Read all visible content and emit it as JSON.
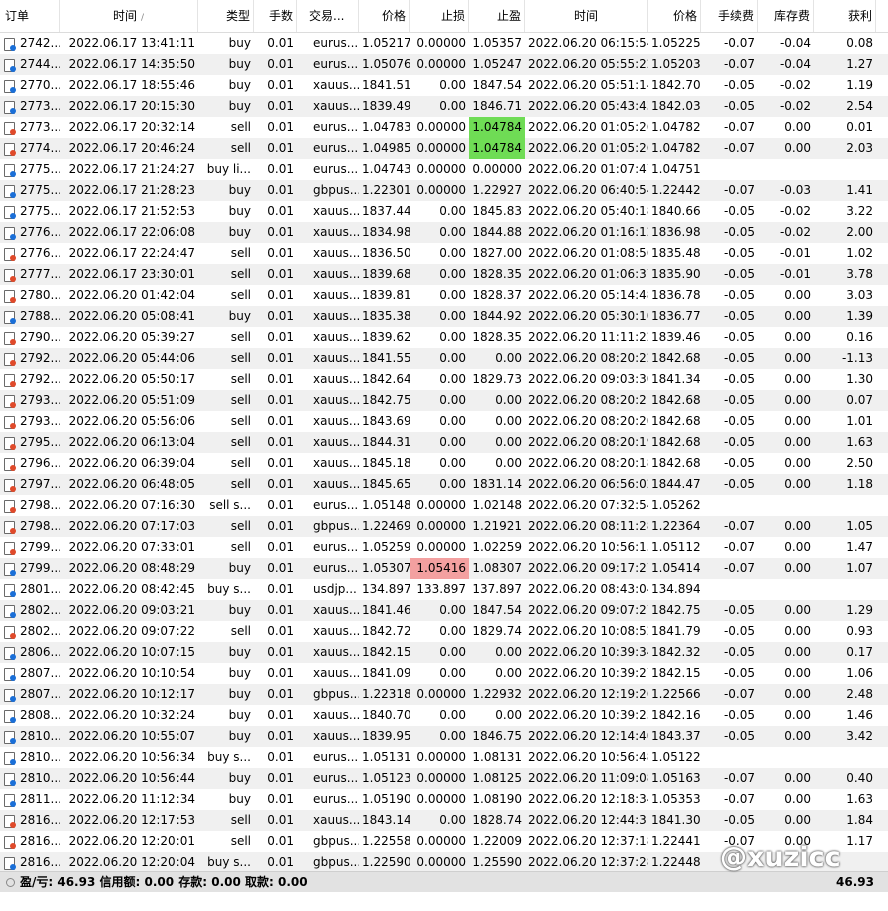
{
  "headers": [
    "订单",
    "时间",
    "类型",
    "手数",
    "交易...",
    "价格",
    "止损",
    "止盈",
    "时间",
    "价格",
    "手续费",
    "库存费",
    "获利"
  ],
  "sort_indicator": "/",
  "rows": [
    {
      "side": "buy",
      "c": [
        "2742...",
        "2022.06.17 13:41:11",
        "buy",
        "0.01",
        "eurus...",
        "1.05217",
        "0.00000",
        "1.05357",
        "2022.06.20 06:15:54",
        "1.05225",
        "-0.07",
        "-0.04",
        "0.08"
      ]
    },
    {
      "side": "buy",
      "c": [
        "2744...",
        "2022.06.17 14:35:50",
        "buy",
        "0.01",
        "eurus...",
        "1.05076",
        "0.00000",
        "1.05247",
        "2022.06.20 05:55:22",
        "1.05203",
        "-0.07",
        "-0.04",
        "1.27"
      ]
    },
    {
      "side": "buy",
      "c": [
        "2770...",
        "2022.06.17 18:55:46",
        "buy",
        "0.01",
        "xauus...",
        "1841.51",
        "0.00",
        "1847.54",
        "2022.06.20 05:51:14",
        "1842.70",
        "-0.05",
        "-0.02",
        "1.19"
      ]
    },
    {
      "side": "buy",
      "c": [
        "2773...",
        "2022.06.17 20:15:30",
        "buy",
        "0.01",
        "xauus...",
        "1839.49",
        "0.00",
        "1846.71",
        "2022.06.20 05:43:43",
        "1842.03",
        "-0.05",
        "-0.02",
        "2.54"
      ]
    },
    {
      "side": "sell",
      "c": [
        "2773...",
        "2022.06.17 20:32:14",
        "sell",
        "0.01",
        "eurus...",
        "1.04783",
        "0.00000",
        "1.04784",
        "2022.06.20 01:05:26",
        "1.04782",
        "-0.07",
        "0.00",
        "0.01"
      ],
      "hl": {
        "7": "g"
      }
    },
    {
      "side": "sell",
      "c": [
        "2774...",
        "2022.06.17 20:46:24",
        "sell",
        "0.01",
        "eurus...",
        "1.04985",
        "0.00000",
        "1.04784",
        "2022.06.20 01:05:26",
        "1.04782",
        "-0.07",
        "0.00",
        "2.03"
      ],
      "hl": {
        "7": "g"
      }
    },
    {
      "side": "buy",
      "c": [
        "2775...",
        "2022.06.17 21:24:27",
        "buy li...",
        "0.01",
        "eurus...",
        "1.04743",
        "0.00000",
        "0.00000",
        "2022.06.20 01:07:47",
        "1.04751",
        "",
        "",
        ""
      ]
    },
    {
      "side": "buy",
      "c": [
        "2775...",
        "2022.06.17 21:28:23",
        "buy",
        "0.01",
        "gbpus...",
        "1.22301",
        "0.00000",
        "1.22927",
        "2022.06.20 06:40:54",
        "1.22442",
        "-0.07",
        "-0.03",
        "1.41"
      ]
    },
    {
      "side": "buy",
      "c": [
        "2775...",
        "2022.06.17 21:52:53",
        "buy",
        "0.01",
        "xauus...",
        "1837.44",
        "0.00",
        "1845.83",
        "2022.06.20 05:40:18",
        "1840.66",
        "-0.05",
        "-0.02",
        "3.22"
      ]
    },
    {
      "side": "buy",
      "c": [
        "2776...",
        "2022.06.17 22:06:08",
        "buy",
        "0.01",
        "xauus...",
        "1834.98",
        "0.00",
        "1844.88",
        "2022.06.20 01:16:12",
        "1836.98",
        "-0.05",
        "-0.02",
        "2.00"
      ]
    },
    {
      "side": "sell",
      "c": [
        "2776...",
        "2022.06.17 22:24:47",
        "sell",
        "0.01",
        "xauus...",
        "1836.50",
        "0.00",
        "1827.00",
        "2022.06.20 01:08:56",
        "1835.48",
        "-0.05",
        "-0.01",
        "1.02"
      ]
    },
    {
      "side": "sell",
      "c": [
        "2777...",
        "2022.06.17 23:30:01",
        "sell",
        "0.01",
        "xauus...",
        "1839.68",
        "0.00",
        "1828.35",
        "2022.06.20 01:06:37",
        "1835.90",
        "-0.05",
        "-0.01",
        "3.78"
      ]
    },
    {
      "side": "sell",
      "c": [
        "2780...",
        "2022.06.20 01:42:04",
        "sell",
        "0.01",
        "xauus...",
        "1839.81",
        "0.00",
        "1828.37",
        "2022.06.20 05:14:48",
        "1836.78",
        "-0.05",
        "0.00",
        "3.03"
      ]
    },
    {
      "side": "buy",
      "c": [
        "2788...",
        "2022.06.20 05:08:41",
        "buy",
        "0.01",
        "xauus...",
        "1835.38",
        "0.00",
        "1844.92",
        "2022.06.20 05:30:10",
        "1836.77",
        "-0.05",
        "0.00",
        "1.39"
      ]
    },
    {
      "side": "sell",
      "c": [
        "2790...",
        "2022.06.20 05:39:27",
        "sell",
        "0.01",
        "xauus...",
        "1839.62",
        "0.00",
        "1828.35",
        "2022.06.20 11:11:22",
        "1839.46",
        "-0.05",
        "0.00",
        "0.16"
      ]
    },
    {
      "side": "sell",
      "c": [
        "2792...",
        "2022.06.20 05:44:06",
        "sell",
        "0.01",
        "xauus...",
        "1841.55",
        "0.00",
        "0.00",
        "2022.06.20 08:20:22",
        "1842.68",
        "-0.05",
        "0.00",
        "-1.13"
      ]
    },
    {
      "side": "sell",
      "c": [
        "2792...",
        "2022.06.20 05:50:17",
        "sell",
        "0.01",
        "xauus...",
        "1842.64",
        "0.00",
        "1829.73",
        "2022.06.20 09:03:30",
        "1841.34",
        "-0.05",
        "0.00",
        "1.30"
      ]
    },
    {
      "side": "sell",
      "c": [
        "2793...",
        "2022.06.20 05:51:09",
        "sell",
        "0.01",
        "xauus...",
        "1842.75",
        "0.00",
        "0.00",
        "2022.06.20 08:20:21",
        "1842.68",
        "-0.05",
        "0.00",
        "0.07"
      ]
    },
    {
      "side": "sell",
      "c": [
        "2793...",
        "2022.06.20 05:56:06",
        "sell",
        "0.01",
        "xauus...",
        "1843.69",
        "0.00",
        "0.00",
        "2022.06.20 08:20:20",
        "1842.68",
        "-0.05",
        "0.00",
        "1.01"
      ]
    },
    {
      "side": "sell",
      "c": [
        "2795...",
        "2022.06.20 06:13:04",
        "sell",
        "0.01",
        "xauus...",
        "1844.31",
        "0.00",
        "0.00",
        "2022.06.20 08:20:19",
        "1842.68",
        "-0.05",
        "0.00",
        "1.63"
      ]
    },
    {
      "side": "sell",
      "c": [
        "2796...",
        "2022.06.20 06:39:04",
        "sell",
        "0.01",
        "xauus...",
        "1845.18",
        "0.00",
        "0.00",
        "2022.06.20 08:20:18",
        "1842.68",
        "-0.05",
        "0.00",
        "2.50"
      ]
    },
    {
      "side": "sell",
      "c": [
        "2797...",
        "2022.06.20 06:48:05",
        "sell",
        "0.01",
        "xauus...",
        "1845.65",
        "0.00",
        "1831.14",
        "2022.06.20 06:56:02",
        "1844.47",
        "-0.05",
        "0.00",
        "1.18"
      ]
    },
    {
      "side": "sell",
      "c": [
        "2798...",
        "2022.06.20 07:16:30",
        "sell s...",
        "0.01",
        "eurus...",
        "1.05148",
        "0.00000",
        "1.02148",
        "2022.06.20 07:32:54",
        "1.05262",
        "",
        "",
        ""
      ]
    },
    {
      "side": "sell",
      "c": [
        "2798...",
        "2022.06.20 07:17:03",
        "sell",
        "0.01",
        "gbpus...",
        "1.22469",
        "0.00000",
        "1.21921",
        "2022.06.20 08:11:28",
        "1.22364",
        "-0.07",
        "0.00",
        "1.05"
      ]
    },
    {
      "side": "sell",
      "c": [
        "2799...",
        "2022.06.20 07:33:01",
        "sell",
        "0.01",
        "eurus...",
        "1.05259",
        "0.00000",
        "1.02259",
        "2022.06.20 10:56:15",
        "1.05112",
        "-0.07",
        "0.00",
        "1.47"
      ]
    },
    {
      "side": "buy",
      "c": [
        "2799...",
        "2022.06.20 08:48:29",
        "buy",
        "0.01",
        "eurus...",
        "1.05307",
        "1.05416",
        "1.08307",
        "2022.06.20 09:17:27",
        "1.05414",
        "-0.07",
        "0.00",
        "1.07"
      ],
      "hl": {
        "6": "r"
      }
    },
    {
      "side": "buy",
      "c": [
        "2801...",
        "2022.06.20 08:42:45",
        "buy s...",
        "0.01",
        "usdjp...",
        "134.897",
        "133.897",
        "137.897",
        "2022.06.20 08:43:04",
        "134.894",
        "",
        "",
        ""
      ]
    },
    {
      "side": "buy",
      "c": [
        "2802...",
        "2022.06.20 09:03:21",
        "buy",
        "0.01",
        "xauus...",
        "1841.46",
        "0.00",
        "1847.54",
        "2022.06.20 09:07:27",
        "1842.75",
        "-0.05",
        "0.00",
        "1.29"
      ]
    },
    {
      "side": "sell",
      "c": [
        "2802...",
        "2022.06.20 09:07:22",
        "sell",
        "0.01",
        "xauus...",
        "1842.72",
        "0.00",
        "1829.74",
        "2022.06.20 10:08:52",
        "1841.79",
        "-0.05",
        "0.00",
        "0.93"
      ]
    },
    {
      "side": "buy",
      "c": [
        "2806...",
        "2022.06.20 10:07:15",
        "buy",
        "0.01",
        "xauus...",
        "1842.15",
        "0.00",
        "0.00",
        "2022.06.20 10:39:34",
        "1842.32",
        "-0.05",
        "0.00",
        "0.17"
      ]
    },
    {
      "side": "buy",
      "c": [
        "2807...",
        "2022.06.20 10:10:54",
        "buy",
        "0.01",
        "xauus...",
        "1841.09",
        "0.00",
        "0.00",
        "2022.06.20 10:39:27",
        "1842.15",
        "-0.05",
        "0.00",
        "1.06"
      ]
    },
    {
      "side": "buy",
      "c": [
        "2807...",
        "2022.06.20 10:12:17",
        "buy",
        "0.01",
        "gbpus...",
        "1.22318",
        "0.00000",
        "1.22932",
        "2022.06.20 12:19:26",
        "1.22566",
        "-0.07",
        "0.00",
        "2.48"
      ]
    },
    {
      "side": "buy",
      "c": [
        "2808...",
        "2022.06.20 10:32:24",
        "buy",
        "0.01",
        "xauus...",
        "1840.70",
        "0.00",
        "0.00",
        "2022.06.20 10:39:23",
        "1842.16",
        "-0.05",
        "0.00",
        "1.46"
      ]
    },
    {
      "side": "buy",
      "c": [
        "2810...",
        "2022.06.20 10:55:07",
        "buy",
        "0.01",
        "xauus...",
        "1839.95",
        "0.00",
        "1846.75",
        "2022.06.20 12:14:40",
        "1843.37",
        "-0.05",
        "0.00",
        "3.42"
      ]
    },
    {
      "side": "buy",
      "c": [
        "2810...",
        "2022.06.20 10:56:34",
        "buy s...",
        "0.01",
        "eurus...",
        "1.05131",
        "0.00000",
        "1.08131",
        "2022.06.20 10:56:48",
        "1.05122",
        "",
        "",
        ""
      ]
    },
    {
      "side": "buy",
      "c": [
        "2810...",
        "2022.06.20 10:56:44",
        "buy",
        "0.01",
        "eurus...",
        "1.05123",
        "0.00000",
        "1.08125",
        "2022.06.20 11:09:08",
        "1.05163",
        "-0.07",
        "0.00",
        "0.40"
      ]
    },
    {
      "side": "buy",
      "c": [
        "2811...",
        "2022.06.20 11:12:34",
        "buy",
        "0.01",
        "eurus...",
        "1.05190",
        "0.00000",
        "1.08190",
        "2022.06.20 12:18:34",
        "1.05353",
        "-0.07",
        "0.00",
        "1.63"
      ]
    },
    {
      "side": "sell",
      "c": [
        "2816...",
        "2022.06.20 12:17:53",
        "sell",
        "0.01",
        "xauus...",
        "1843.14",
        "0.00",
        "1828.74",
        "2022.06.20 12:44:31",
        "1841.30",
        "-0.05",
        "0.00",
        "1.84"
      ]
    },
    {
      "side": "sell",
      "c": [
        "2816...",
        "2022.06.20 12:20:01",
        "sell",
        "0.01",
        "gbpus...",
        "1.22558",
        "0.00000",
        "1.22009",
        "2022.06.20 12:37:18",
        "1.22441",
        "-0.07",
        "0.00",
        "1.17"
      ]
    },
    {
      "side": "buy",
      "c": [
        "2816...",
        "2022.06.20 12:20:04",
        "buy s...",
        "0.01",
        "gbpus...",
        "1.22590",
        "0.00000",
        "1.25590",
        "2022.06.20 12:37:28",
        "1.22448",
        "",
        "",
        ""
      ]
    }
  ],
  "status": {
    "summary": "盈/亏: 46.93  信用额: 0.00  存款: 0.00  取款: 0.00",
    "total": "46.93"
  },
  "watermark": "@xuzicc",
  "colors": {
    "tp_hit": "#6fdc55",
    "sl_hit": "#f3a0a0",
    "buy_icon": "#1a6fd8",
    "sell_icon": "#e04a2a"
  }
}
